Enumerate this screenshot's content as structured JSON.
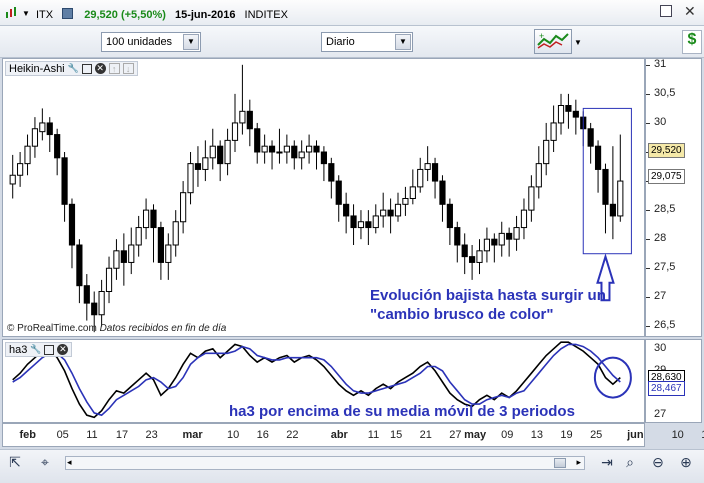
{
  "window": {
    "symbol": "ITX",
    "price_change": "29,520 (+5,50%)",
    "date": "15-jun-2016",
    "name": "INDITEX"
  },
  "toolbar": {
    "units_select": "100 unidades",
    "period_select": "Diario"
  },
  "main_panel": {
    "indicator_name": "Heikin-Ashi",
    "price_axis_ticks": [
      "31",
      "30,5",
      "30",
      "29,5",
      "29",
      "28,5",
      "28",
      "27,5",
      "27",
      "26,5"
    ],
    "last_price_label": "29,520",
    "second_price_label": "29,075",
    "copyright_brand": "© ProRealTime.com",
    "copyright_note": "Datos recibidos en fin de día",
    "annotation_line1": "Evolución bajista hasta surgir un",
    "annotation_line2": "\"cambio brusco de color\""
  },
  "sub_panel": {
    "indicator_name": "ha3",
    "axis_ticks": [
      "30",
      "29",
      "28",
      "27"
    ],
    "value_label_1": "28,630",
    "value_label_2": "28,467",
    "annotation": "ha3 por encima de su media móvil de 3 periodos"
  },
  "x_axis": {
    "labels": [
      "feb",
      "05",
      "11",
      "17",
      "23",
      "mar",
      "10",
      "16",
      "22",
      "abr",
      "11",
      "15",
      "21",
      "27",
      "may",
      "09",
      "13",
      "19",
      "25",
      "jun",
      "10",
      "16"
    ]
  },
  "colors": {
    "bull": "#ffffff",
    "bear": "#000000",
    "ha3_line": "#000000",
    "ma_line": "#2b33b8",
    "annotation": "#2b33b8",
    "last_price_bg": "#f5e9a8",
    "price_up": "#1a8a1a"
  },
  "chart_data": {
    "type": "candlestick",
    "series_main": {
      "name": "Heikin-Ashi",
      "ylim": [
        26.3,
        31.1
      ],
      "candles": [
        [
          29.1,
          28.95,
          29.45,
          28.7
        ],
        [
          29.3,
          29.1,
          29.5,
          28.9
        ],
        [
          29.6,
          29.3,
          29.8,
          29.1
        ],
        [
          29.9,
          29.6,
          30.1,
          29.4
        ],
        [
          30.0,
          29.85,
          30.25,
          29.7
        ],
        [
          29.8,
          30.0,
          30.1,
          29.5
        ],
        [
          29.4,
          29.8,
          29.9,
          29.1
        ],
        [
          28.6,
          29.4,
          29.5,
          28.3
        ],
        [
          27.9,
          28.6,
          28.7,
          27.5
        ],
        [
          27.2,
          27.9,
          28.0,
          26.9
        ],
        [
          26.9,
          27.2,
          27.4,
          26.6
        ],
        [
          26.7,
          26.9,
          27.1,
          26.4
        ],
        [
          27.1,
          26.7,
          27.3,
          26.5
        ],
        [
          27.5,
          27.1,
          27.7,
          26.9
        ],
        [
          27.8,
          27.5,
          28.0,
          27.3
        ],
        [
          27.6,
          27.8,
          28.1,
          27.2
        ],
        [
          27.9,
          27.6,
          28.2,
          27.4
        ],
        [
          28.2,
          27.9,
          28.4,
          27.7
        ],
        [
          28.5,
          28.2,
          28.7,
          28.0
        ],
        [
          28.2,
          28.5,
          28.6,
          27.6
        ],
        [
          27.6,
          28.2,
          28.3,
          27.3
        ],
        [
          27.9,
          27.6,
          28.1,
          27.3
        ],
        [
          28.3,
          27.9,
          28.5,
          27.7
        ],
        [
          28.8,
          28.3,
          29.0,
          28.1
        ],
        [
          29.3,
          28.8,
          29.5,
          28.6
        ],
        [
          29.2,
          29.3,
          29.6,
          28.9
        ],
        [
          29.4,
          29.2,
          29.7,
          29.0
        ],
        [
          29.6,
          29.4,
          29.9,
          29.2
        ],
        [
          29.3,
          29.6,
          29.7,
          29.0
        ],
        [
          29.7,
          29.3,
          29.9,
          29.1
        ],
        [
          30.0,
          29.7,
          30.5,
          29.5
        ],
        [
          30.2,
          30.0,
          31.0,
          29.8
        ],
        [
          29.9,
          30.2,
          30.4,
          29.6
        ],
        [
          29.5,
          29.9,
          30.0,
          29.3
        ],
        [
          29.6,
          29.5,
          29.8,
          29.3
        ],
        [
          29.5,
          29.6,
          29.7,
          29.2
        ],
        [
          29.5,
          29.5,
          29.9,
          29.3
        ],
        [
          29.6,
          29.5,
          29.8,
          29.3
        ],
        [
          29.4,
          29.6,
          29.7,
          29.2
        ],
        [
          29.5,
          29.4,
          29.7,
          29.2
        ],
        [
          29.6,
          29.5,
          29.8,
          29.3
        ],
        [
          29.5,
          29.6,
          29.7,
          29.2
        ],
        [
          29.3,
          29.5,
          29.6,
          29.0
        ],
        [
          29.0,
          29.3,
          29.4,
          28.7
        ],
        [
          28.6,
          29.0,
          29.1,
          28.3
        ],
        [
          28.4,
          28.6,
          28.8,
          28.1
        ],
        [
          28.2,
          28.4,
          28.6,
          27.9
        ],
        [
          28.3,
          28.2,
          28.5,
          28.0
        ],
        [
          28.2,
          28.3,
          28.5,
          27.9
        ],
        [
          28.4,
          28.2,
          28.6,
          28.1
        ],
        [
          28.5,
          28.4,
          28.8,
          28.2
        ],
        [
          28.4,
          28.5,
          28.7,
          28.1
        ],
        [
          28.6,
          28.4,
          28.8,
          28.3
        ],
        [
          28.7,
          28.6,
          28.9,
          28.4
        ],
        [
          28.9,
          28.7,
          29.2,
          28.6
        ],
        [
          29.2,
          28.9,
          29.4,
          28.8
        ],
        [
          29.3,
          29.2,
          29.6,
          29.0
        ],
        [
          29.0,
          29.3,
          29.4,
          28.7
        ],
        [
          28.6,
          29.0,
          29.1,
          28.3
        ],
        [
          28.2,
          28.6,
          28.7,
          27.9
        ],
        [
          27.9,
          28.2,
          28.3,
          27.6
        ],
        [
          27.7,
          27.9,
          28.1,
          27.4
        ],
        [
          27.6,
          27.7,
          27.9,
          27.3
        ],
        [
          27.8,
          27.6,
          28.0,
          27.4
        ],
        [
          28.0,
          27.8,
          28.2,
          27.6
        ],
        [
          27.9,
          28.0,
          28.1,
          27.6
        ],
        [
          28.1,
          27.9,
          28.3,
          27.7
        ],
        [
          28.0,
          28.1,
          28.2,
          27.7
        ],
        [
          28.2,
          28.0,
          28.4,
          27.8
        ],
        [
          28.5,
          28.2,
          28.7,
          28.0
        ],
        [
          28.9,
          28.5,
          29.1,
          28.3
        ],
        [
          29.3,
          28.9,
          29.6,
          28.7
        ],
        [
          29.7,
          29.3,
          30.0,
          29.1
        ],
        [
          30.0,
          29.7,
          30.3,
          29.5
        ],
        [
          30.3,
          30.0,
          30.5,
          29.8
        ],
        [
          30.2,
          30.3,
          30.5,
          29.9
        ],
        [
          30.1,
          30.2,
          30.4,
          29.8
        ],
        [
          29.9,
          30.1,
          30.2,
          29.6
        ],
        [
          29.6,
          29.9,
          30.0,
          29.3
        ],
        [
          29.2,
          29.6,
          29.7,
          28.8
        ],
        [
          28.6,
          29.2,
          29.3,
          28.1
        ],
        [
          28.4,
          28.6,
          29.6,
          28.0
        ],
        [
          29.0,
          28.4,
          29.8,
          28.3
        ]
      ]
    },
    "series_sub": {
      "name": "ha3",
      "ylim": [
        26.6,
        30.4
      ],
      "ha3": [
        28.6,
        28.9,
        29.3,
        29.6,
        29.9,
        30.0,
        29.6,
        29.0,
        28.2,
        27.5,
        27.0,
        26.9,
        27.2,
        27.7,
        28.1,
        28.0,
        28.3,
        28.6,
        28.9,
        28.6,
        27.9,
        28.2,
        28.7,
        29.3,
        29.8,
        29.6,
        29.9,
        30.0,
        29.6,
        29.9,
        30.2,
        30.1,
        29.7,
        29.4,
        29.6,
        29.4,
        29.6,
        29.7,
        29.4,
        29.6,
        29.7,
        29.5,
        29.2,
        28.8,
        28.4,
        28.1,
        27.9,
        28.1,
        27.9,
        28.2,
        28.4,
        28.2,
        28.5,
        28.7,
        28.9,
        29.2,
        29.4,
        29.0,
        28.5,
        28.0,
        27.7,
        27.5,
        27.4,
        27.7,
        27.9,
        27.7,
        28.0,
        27.8,
        28.1,
        28.5,
        28.9,
        29.3,
        29.7,
        30.0,
        30.3,
        30.3,
        30.1,
        29.9,
        29.6,
        29.3,
        28.7,
        28.4,
        28.7
      ],
      "ma3": [
        28.5,
        28.7,
        29.0,
        29.3,
        29.6,
        29.8,
        29.8,
        29.5,
        28.9,
        28.2,
        27.6,
        27.1,
        27.0,
        27.3,
        27.7,
        27.9,
        28.1,
        28.3,
        28.6,
        28.7,
        28.5,
        28.2,
        28.3,
        28.7,
        29.3,
        29.6,
        29.8,
        29.8,
        29.8,
        29.8,
        29.9,
        30.1,
        30.0,
        29.7,
        29.6,
        29.5,
        29.5,
        29.6,
        29.6,
        29.6,
        29.6,
        29.6,
        29.5,
        29.2,
        28.8,
        28.4,
        28.1,
        28.0,
        28.0,
        28.1,
        28.2,
        28.3,
        28.4,
        28.5,
        28.7,
        28.9,
        29.2,
        29.2,
        29.0,
        28.5,
        28.1,
        27.7,
        27.5,
        27.5,
        27.7,
        27.8,
        27.9,
        27.8,
        28.0,
        28.1,
        28.5,
        28.9,
        29.3,
        29.7,
        30.0,
        30.2,
        30.2,
        30.1,
        29.9,
        29.6,
        29.2,
        28.8,
        28.5
      ]
    },
    "x_tick_labels": [
      "feb",
      "05",
      "11",
      "17",
      "23",
      "mar",
      "10",
      "16",
      "22",
      "abr",
      "11",
      "15",
      "21",
      "27",
      "may",
      "09",
      "13",
      "19",
      "25",
      "jun",
      "10",
      "16"
    ],
    "x_tick_bar_index": [
      2,
      7,
      11,
      15,
      19,
      24,
      30,
      34,
      38,
      44,
      49,
      52,
      56,
      60,
      62,
      67,
      71,
      75,
      79,
      84,
      90,
      94
    ]
  }
}
